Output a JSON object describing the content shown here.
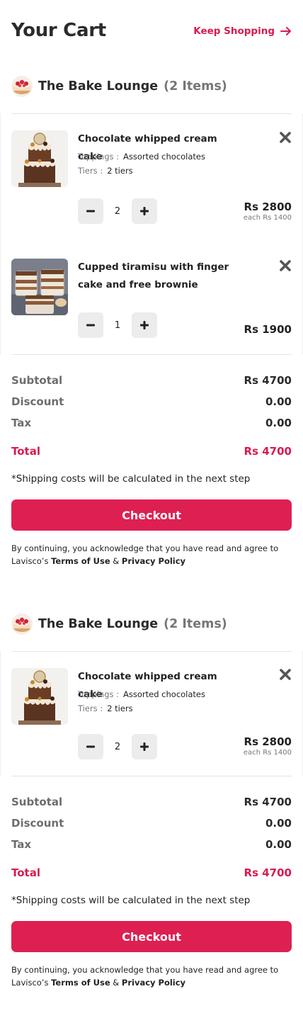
{
  "header": {
    "title": "Your Cart",
    "keep_shopping": "Keep Shopping"
  },
  "colors": {
    "accent": "#de1f52",
    "accent_text": "#d81b4e"
  },
  "icons": {
    "remove": "close-x-icon",
    "minus": "minus-icon",
    "plus": "plus-icon",
    "arrow": "arrow-right-icon"
  },
  "carts": [
    {
      "shop_name": "The Bake Lounge",
      "item_count": "(2 Items)",
      "items": [
        {
          "name": "Chocolate whipped cream cake",
          "toppings_label": "Toppings :",
          "toppings_value": "Assorted chocolates",
          "tiers_label": "Tiers :",
          "tiers_value": "2 tiers",
          "quantity": "2",
          "price": "Rs 2800",
          "each": "each Rs 1400"
        },
        {
          "name": "Cupped tiramisu with finger cake and free brownie",
          "quantity": "1",
          "price": "Rs 1900"
        }
      ],
      "summary": {
        "subtotal_label": "Subtotal",
        "subtotal": "Rs 4700",
        "discount_label": "Discount",
        "discount": "0.00",
        "tax_label": "Tax",
        "tax": "0.00",
        "total_label": "Total",
        "total": "Rs 4700"
      },
      "shipping_note": "*Shipping costs will be calculated in the next step",
      "checkout_label": "Checkout",
      "legal": {
        "text_before": "By continuing, you acknowledge that you have read and agree to Lavisco’s",
        "terms": "Terms of Use",
        "and": "&",
        "privacy": "Privacy Policy"
      }
    },
    {
      "shop_name": "The Bake Lounge",
      "item_count": "(2 Items)",
      "items": [
        {
          "name": "Chocolate whipped cream cake",
          "toppings_label": "Toppings :",
          "toppings_value": "Assorted chocolates",
          "tiers_label": "Tiers :",
          "tiers_value": "2 tiers",
          "quantity": "2",
          "price": "Rs 2800",
          "each": "each Rs 1400"
        }
      ],
      "summary": {
        "subtotal_label": "Subtotal",
        "subtotal": "Rs 4700",
        "discount_label": "Discount",
        "discount": "0.00",
        "tax_label": "Tax",
        "tax": "0.00",
        "total_label": "Total",
        "total": "Rs 4700"
      },
      "shipping_note": "*Shipping costs will be calculated in the next step",
      "checkout_label": "Checkout",
      "legal": {
        "text_before": "By continuing, you acknowledge that you have read and agree to Lavisco’s",
        "terms": "Terms of Use",
        "and": "&",
        "privacy": "Privacy Policy"
      }
    }
  ]
}
